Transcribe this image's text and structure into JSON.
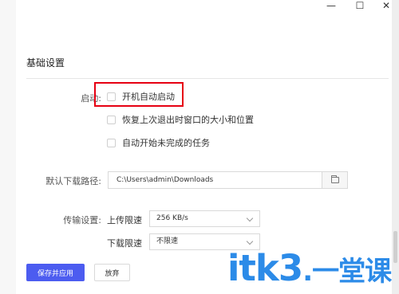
{
  "window": {
    "minimize_glyph": "—",
    "maximize_glyph": "☐",
    "close_glyph": "✕"
  },
  "section": {
    "title": "基础设置"
  },
  "startup": {
    "label": "启动:",
    "options": [
      {
        "label": "开机自动启动",
        "checked": false
      },
      {
        "label": "恢复上次退出时窗口的大小和位置",
        "checked": false
      },
      {
        "label": "自动开始未完成的任务",
        "checked": false
      }
    ]
  },
  "download_path": {
    "label": "默认下载路径:",
    "value": "C:\\Users\\admin\\Downloads",
    "browse_icon": "folder-icon"
  },
  "transfer": {
    "label": "传输设置:",
    "upload_label": "上传限速",
    "upload_value": "256 KB/s",
    "download_label": "下载限速",
    "download_value": "不限速"
  },
  "actions": {
    "save_label": "保存并应用",
    "discard_label": "放弃"
  },
  "watermark": {
    "brand": "itk3",
    "suffix": ".一堂课"
  },
  "colors": {
    "primary": "#4c5cf0",
    "highlight": "#e60012",
    "watermark": "#2c8be8"
  }
}
